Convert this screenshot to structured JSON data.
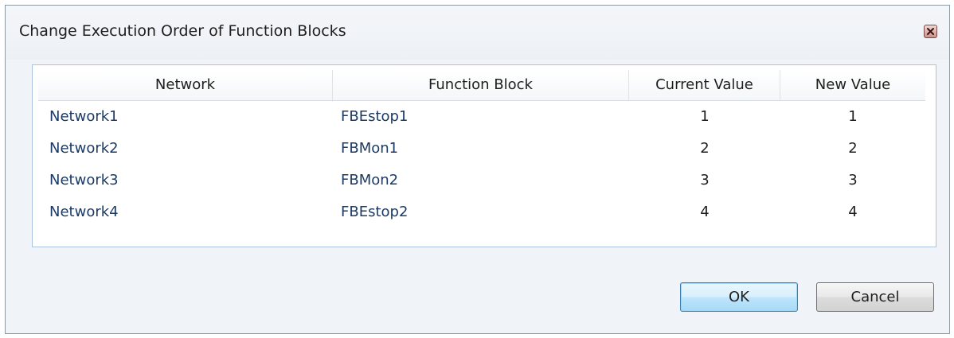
{
  "dialog": {
    "title": "Change Execution Order of Function Blocks",
    "close_icon": "close-icon"
  },
  "grid": {
    "columns": [
      "Network",
      "Function Block",
      "Current Value",
      "New Value"
    ],
    "rows": [
      {
        "network": "Network1",
        "function_block": "FBEstop1",
        "current_value": "1",
        "new_value": "1"
      },
      {
        "network": "Network2",
        "function_block": "FBMon1",
        "current_value": "2",
        "new_value": "2"
      },
      {
        "network": "Network3",
        "function_block": "FBMon2",
        "current_value": "3",
        "new_value": "3"
      },
      {
        "network": "Network4",
        "function_block": "FBEstop2",
        "current_value": "4",
        "new_value": "4"
      }
    ]
  },
  "buttons": {
    "ok_label": "OK",
    "cancel_label": "Cancel"
  },
  "colors": {
    "link_text": "#1b3a66",
    "grid_border": "#a9c2dd",
    "ok_border": "#3c7fb1"
  }
}
